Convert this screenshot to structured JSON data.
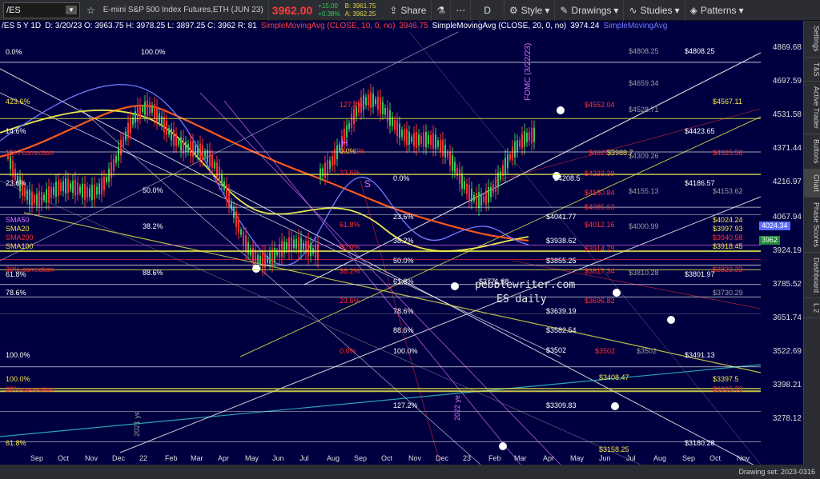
{
  "toolbar": {
    "symbol": "/ES",
    "description": "E-mini S&P 500 Index Futures,ETH (JUN 23)",
    "price": "3962.00",
    "change_top": "+15.00",
    "change_bottom": "+0.38%",
    "bid": "B: 3961.75",
    "ask": "A: 3962.25",
    "share": "Share",
    "d": "D",
    "style": "Style",
    "drawings": "Drawings",
    "studies": "Studies",
    "patterns": "Patterns"
  },
  "header": {
    "symbol_line": "/ES 5 Y 1D",
    "ohlc": "D: 3/20/23  O: 3963.75  H: 3978.25  L: 3897.25  C: 3962  R: 81",
    "sma10": "SimpleMovingAvg (CLOSE, 10, 0, no)",
    "sma10_val": "3946.75",
    "sma20": "SimpleMovingAvg (CLOSE, 20, 0, no)",
    "sma20_val": "3974.24",
    "sma_more": "SimpleMovingAvg"
  },
  "y_axis": [
    "4869.68",
    "4697.59",
    "4531.58",
    "4371.44",
    "4216.97",
    "4067.94",
    "3924.19",
    "3785.52",
    "3651.74",
    "3522.69",
    "3398.21",
    "3278.12"
  ],
  "price_badges": {
    "blue": "4024.34",
    "green": "3962"
  },
  "x_axis": [
    "Sep",
    "Oct",
    "Nov",
    "Dec",
    "22",
    "Feb",
    "Mar",
    "Apr",
    "May",
    "Jun",
    "Jul",
    "Aug",
    "Sep",
    "Oct",
    "Nov",
    "Dec",
    "23",
    "Feb",
    "Mar",
    "Apr",
    "May",
    "Jun",
    "Jul",
    "Aug",
    "Sep",
    "Oct",
    "Nov"
  ],
  "labels": {
    "white": [
      "$4808.25",
      "$4423.65",
      "$4186.57",
      "$4041.77",
      "$3938.62",
      "$3855.25",
      "$3801.97",
      "$3771.88",
      "$3639.19",
      "$3582.54",
      "$3502",
      "$3491.13",
      "$3309.83",
      "$3180.28",
      "$4208.5"
    ],
    "gray": [
      "$4808.25",
      "$4659.34",
      "$4528.71",
      "$4309.26",
      "$4155.13",
      "$4153.62",
      "$4000.99",
      "$3810.28",
      "$3730.29",
      "$3502"
    ],
    "red": [
      "$4552.04",
      "$4327.5",
      "$4233.39",
      "$4150.84",
      "$4085.63",
      "$4012.16",
      "$3914.79",
      "$3817.34",
      "$3696.82",
      "$3502",
      "$4325.58",
      "$3823.33",
      "$3365.78",
      "$3940.58"
    ],
    "yellow": [
      "$4567.11",
      "$4024.24",
      "$3997.93",
      "$3918.45",
      "$3408.47",
      "$3397.5",
      "$3158.25",
      "$3988.7"
    ],
    "fib_white": [
      "0.0%",
      "100.0%",
      "14.6%",
      "23.6%",
      "38.2%",
      "50.0%",
      "61.8%",
      "78.6%",
      "88.6%",
      "100.0%",
      "23.6%",
      "38.2%",
      "50.0%",
      "61.8%",
      "78.6%",
      "88.6%",
      "100.0%",
      "127.2%",
      "0.0%"
    ],
    "fib_yellow": [
      "423.6%",
      "0.0%",
      "100.0%",
      "61.8%"
    ],
    "fib_red": [
      "127.2%",
      "10% correction",
      "30% correction",
      "23.6%",
      "0.0%",
      "38.2%",
      "23.6%",
      "0.0%",
      "50.0%",
      "30% correction"
    ],
    "sma": [
      "SMA50",
      "SMA200",
      "SMA20",
      "SMA100",
      "61.8%"
    ],
    "watermark1": "pebblewriter.com",
    "watermark2": "ES daily",
    "fomc": "FOMC (3/22/23)",
    "year_tag": "2022 ye",
    "year_tag2": "2021 ye",
    "markH": "H",
    "markS": "S"
  },
  "right_tabs": [
    "Settings",
    "T&S",
    "Active Trader",
    "Buttons",
    "Chart",
    "Phase Scores",
    "Dashboard",
    "L 2"
  ],
  "bottom": "Drawing set: 2023-0316",
  "colors": {
    "bg": "#000040",
    "up": "#34c759",
    "down": "#ff3030",
    "sma": "#e8e84a",
    "price": "#ff3b3b"
  }
}
